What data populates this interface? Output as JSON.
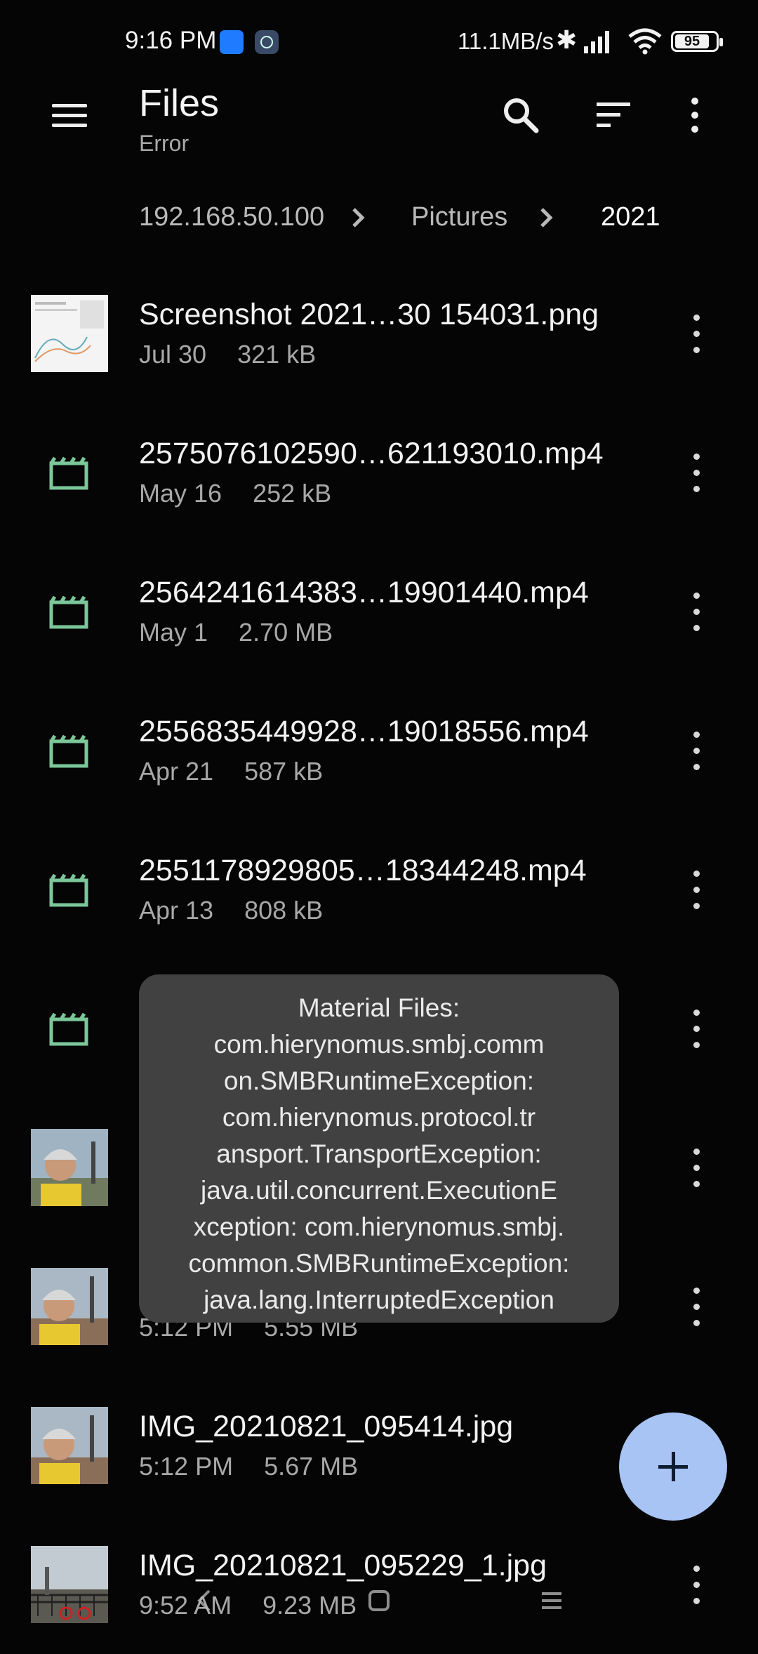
{
  "status_bar": {
    "time": "9:16 PM",
    "network_speed": "11.1MB/s",
    "battery": "95"
  },
  "app_bar": {
    "title": "Files",
    "subtitle": "Error",
    "icons": [
      "menu-icon",
      "search-icon",
      "sort-icon",
      "more-vert-icon"
    ]
  },
  "breadcrumbs": [
    {
      "label": "192.168.50.100"
    },
    {
      "label": "Pictures"
    },
    {
      "label": "2021"
    }
  ],
  "files": [
    {
      "name": "Screenshot 2021…30 154031.png",
      "date": "Jul 30",
      "size": "321 kB",
      "type": "image"
    },
    {
      "name": "2575076102590…621193010.mp4",
      "date": "May 16",
      "size": "252 kB",
      "type": "video"
    },
    {
      "name": "2564241614383…19901440.mp4",
      "date": "May 1",
      "size": "2.70 MB",
      "type": "video"
    },
    {
      "name": "2556835449928…19018556.mp4",
      "date": "Apr 21",
      "size": "587 kB",
      "type": "video"
    },
    {
      "name": "2551178929805…18344248.mp4",
      "date": "Apr 13",
      "size": "808 kB",
      "type": "video"
    },
    {
      "name": "",
      "date": "",
      "size": "",
      "type": "video"
    },
    {
      "name": "",
      "date": "",
      "size": "",
      "type": "image"
    },
    {
      "name": "",
      "date": "5:12 PM",
      "size": "5.55 MB",
      "type": "image"
    },
    {
      "name": "IMG_20210821_095414.jpg",
      "date": "5:12 PM",
      "size": "5.67 MB",
      "type": "image"
    },
    {
      "name": "IMG_20210821_095229_1.jpg",
      "date": "9:52 AM",
      "size": "9.23 MB",
      "type": "image"
    }
  ],
  "toast": {
    "lines": [
      "Material Files:",
      "com.hierynomus.smbj.comm",
      "on.SMBRuntimeException:",
      "com.hierynomus.protocol.tr",
      "ansport.TransportException:",
      "java.util.concurrent.ExecutionE",
      "xception: com.hierynomus.smbj.",
      "common.SMBRuntimeException:",
      "java.lang.InterruptedException"
    ]
  },
  "fab": {
    "icon": "plus-icon"
  },
  "colors": {
    "background": "#050505",
    "video_icon": "#7cc79a",
    "fab": "#a7c4f5",
    "toast": "#414141"
  }
}
